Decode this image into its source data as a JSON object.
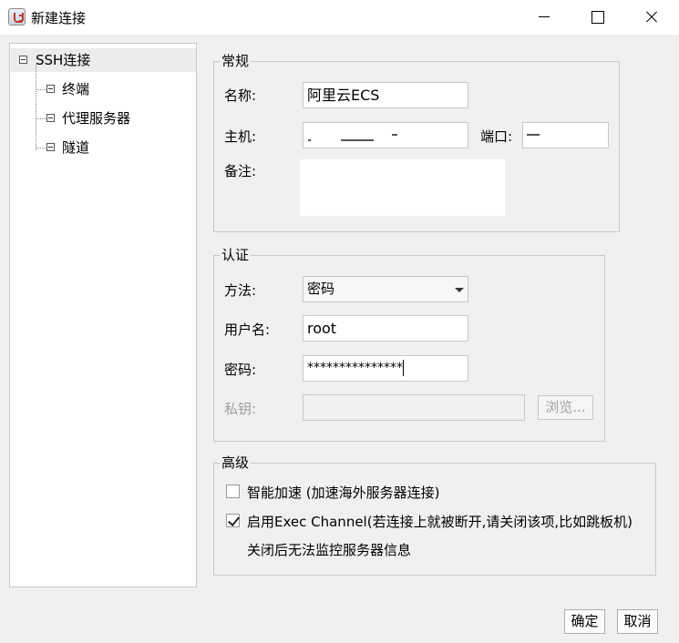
{
  "window": {
    "title": "新建连接",
    "controls": [
      "minimize-icon",
      "maximize-icon",
      "close-icon"
    ]
  },
  "tree": {
    "root": "SSH连接",
    "children": [
      "终端",
      "代理服务器",
      "隧道"
    ]
  },
  "general": {
    "legend": "常规",
    "name_label": "名称:",
    "name_value": "阿里云ECS",
    "host_label": "主机:",
    "host_value": "",
    "port_label": "端口:",
    "port_value": "",
    "note_label": "备注:",
    "note_value": ""
  },
  "auth": {
    "legend": "认证",
    "method_label": "方法:",
    "method_value": "密码",
    "username_label": "用户名:",
    "username_value": "root",
    "password_label": "密码:",
    "password_value": "***************",
    "privatekey_label": "私钥:",
    "privatekey_value": "",
    "browse_label": "浏览..."
  },
  "advanced": {
    "legend": "高级",
    "smart_accel_label": "智能加速 (加速海外服务器连接)",
    "smart_accel_checked": false,
    "exec_channel_label": "启用Exec Channel(若连接上就被断开,请关闭该项,比如跳板机)",
    "exec_channel_checked": true,
    "exec_channel_note": "关闭后无法监控服务器信息"
  },
  "footer": {
    "ok_label": "确定",
    "cancel_label": "取消"
  }
}
